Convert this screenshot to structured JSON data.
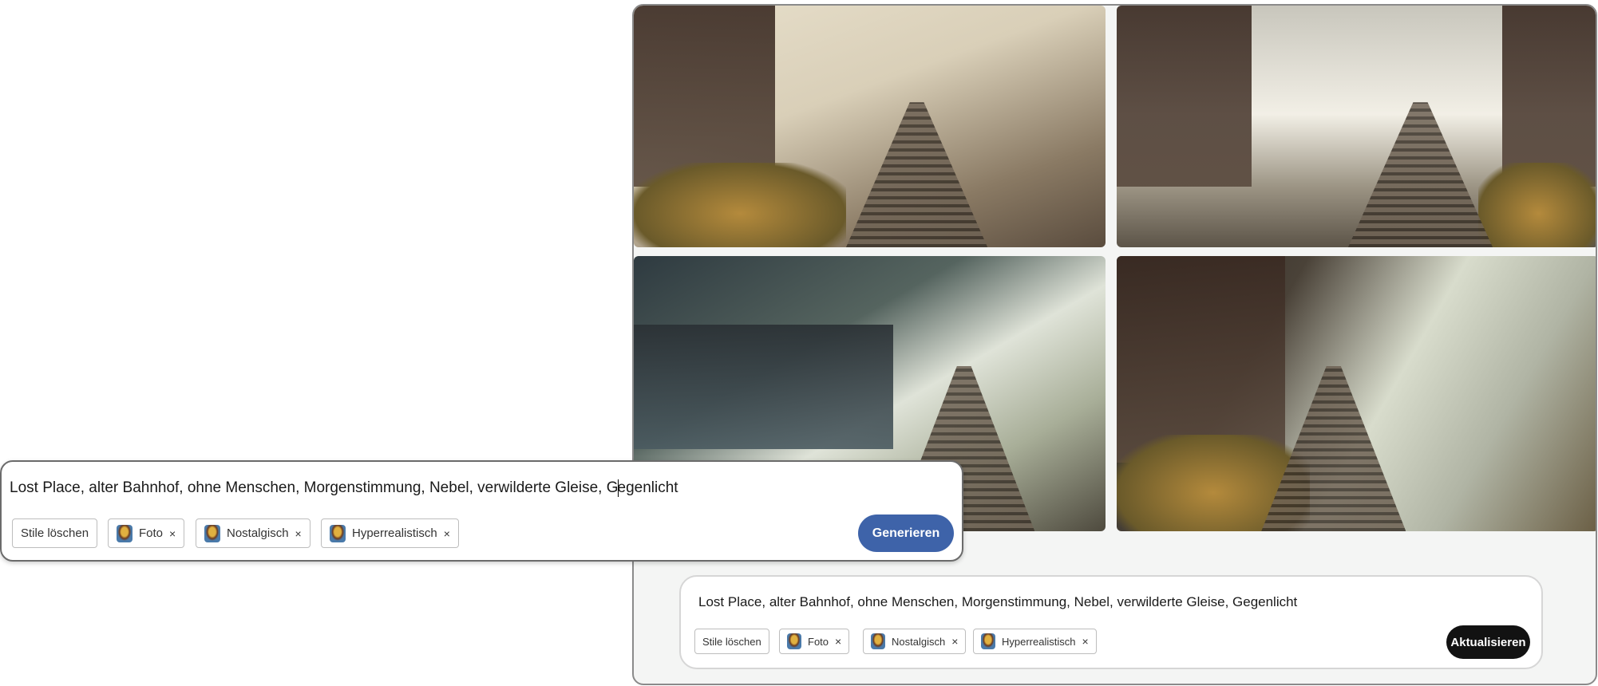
{
  "prompt_text": "Lost Place, alter Bahnhof, ohne Menschen, Morgenstimmung, Nebel, verwilderte Gleise, Gegenlicht",
  "floating_editor": {
    "text_before_cursor": "Lost Place, alter Bahnhof, ohne Menschen, Morgenstimmung, Nebel, verwilderte Gleise, G",
    "text_after_cursor": "egenlicht",
    "clear_styles_label": "Stile löschen",
    "styles": [
      {
        "label": "Foto"
      },
      {
        "label": "Nostalgisch"
      },
      {
        "label": "Hyperrealistisch"
      }
    ],
    "remove_icon": "×",
    "generate_label": "Generieren",
    "generate_color": "#3e63a9"
  },
  "bottom_editor": {
    "text": "Lost Place, alter Bahnhof, ohne Menschen, Morgenstimmung, Nebel, verwilderte Gleise, Gegenlicht",
    "clear_styles_label": "Stile löschen",
    "styles": [
      {
        "label": "Foto"
      },
      {
        "label": "Nostalgisch"
      },
      {
        "label": "Hyperrealistisch"
      }
    ],
    "remove_icon": "×",
    "update_label": "Aktualisieren",
    "update_color": "#121212"
  }
}
